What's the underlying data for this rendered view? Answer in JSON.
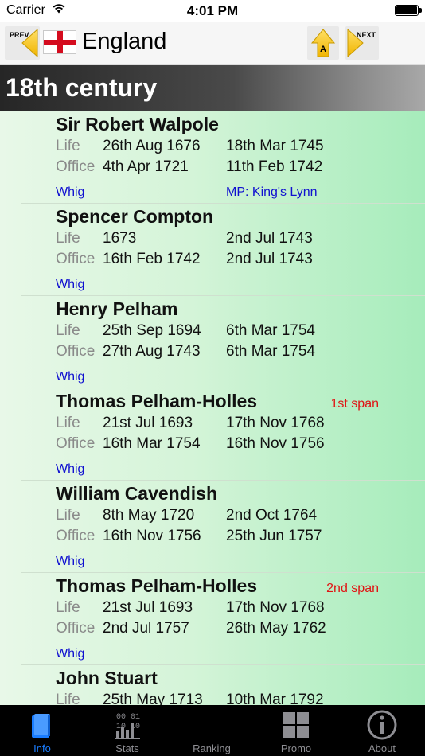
{
  "status_bar": {
    "carrier": "Carrier",
    "time": "4:01 PM"
  },
  "nav": {
    "prev_label": "PREV",
    "next_label": "NEXT",
    "az_label": "A",
    "title": "England"
  },
  "century": {
    "title": "18th century"
  },
  "field_labels": {
    "life": "Life",
    "office": "Office"
  },
  "entries": [
    {
      "name": "Sir Robert Walpole",
      "span_note": "",
      "life_start": "26th Aug 1676",
      "life_end": "18th Mar 1745",
      "office_start": "4th Apr 1721",
      "office_end": "11th Feb 1742",
      "party": "Whig",
      "constituency": "MP: King's Lynn"
    },
    {
      "name": "Spencer Compton",
      "span_note": "",
      "life_start": "1673",
      "life_end": "2nd Jul 1743",
      "office_start": "16th Feb 1742",
      "office_end": "2nd Jul 1743",
      "party": "Whig",
      "constituency": ""
    },
    {
      "name": "Henry Pelham",
      "span_note": "",
      "life_start": "25th Sep 1694",
      "life_end": "6th Mar 1754",
      "office_start": "27th Aug 1743",
      "office_end": "6th Mar 1754",
      "party": "Whig",
      "constituency": ""
    },
    {
      "name": "Thomas Pelham-Holles",
      "span_note": "1st span",
      "life_start": "21st Jul 1693",
      "life_end": "17th Nov 1768",
      "office_start": "16th Mar 1754",
      "office_end": "16th Nov 1756",
      "party": "Whig",
      "constituency": ""
    },
    {
      "name": "William Cavendish",
      "span_note": "",
      "life_start": "8th May 1720",
      "life_end": "2nd Oct 1764",
      "office_start": "16th Nov 1756",
      "office_end": "25th Jun 1757",
      "party": "Whig",
      "constituency": ""
    },
    {
      "name": "Thomas Pelham-Holles",
      "span_note": "2nd span",
      "life_start": "21st Jul 1693",
      "life_end": "17th Nov 1768",
      "office_start": "2nd Jul 1757",
      "office_end": "26th May 1762",
      "party": "Whig",
      "constituency": ""
    },
    {
      "name": "John Stuart",
      "span_note": "",
      "life_start": "25th May 1713",
      "life_end": "10th Mar 1792",
      "office_start": "",
      "office_end": "",
      "party": "",
      "constituency": ""
    }
  ],
  "tabs": [
    {
      "label": "Info",
      "icon": "book-icon",
      "active": true
    },
    {
      "label": "Stats",
      "icon": "binary-data-icon",
      "active": false
    },
    {
      "label": "Ranking",
      "icon": "ranking-icon",
      "active": false
    },
    {
      "label": "Promo",
      "icon": "grid-icon",
      "active": false
    },
    {
      "label": "About",
      "icon": "info-circle-icon",
      "active": false
    }
  ],
  "colors": {
    "active_tab": "#1a7dff",
    "party": "#1010d0",
    "span_note": "#e01414",
    "flag_red": "#d40b1e"
  }
}
